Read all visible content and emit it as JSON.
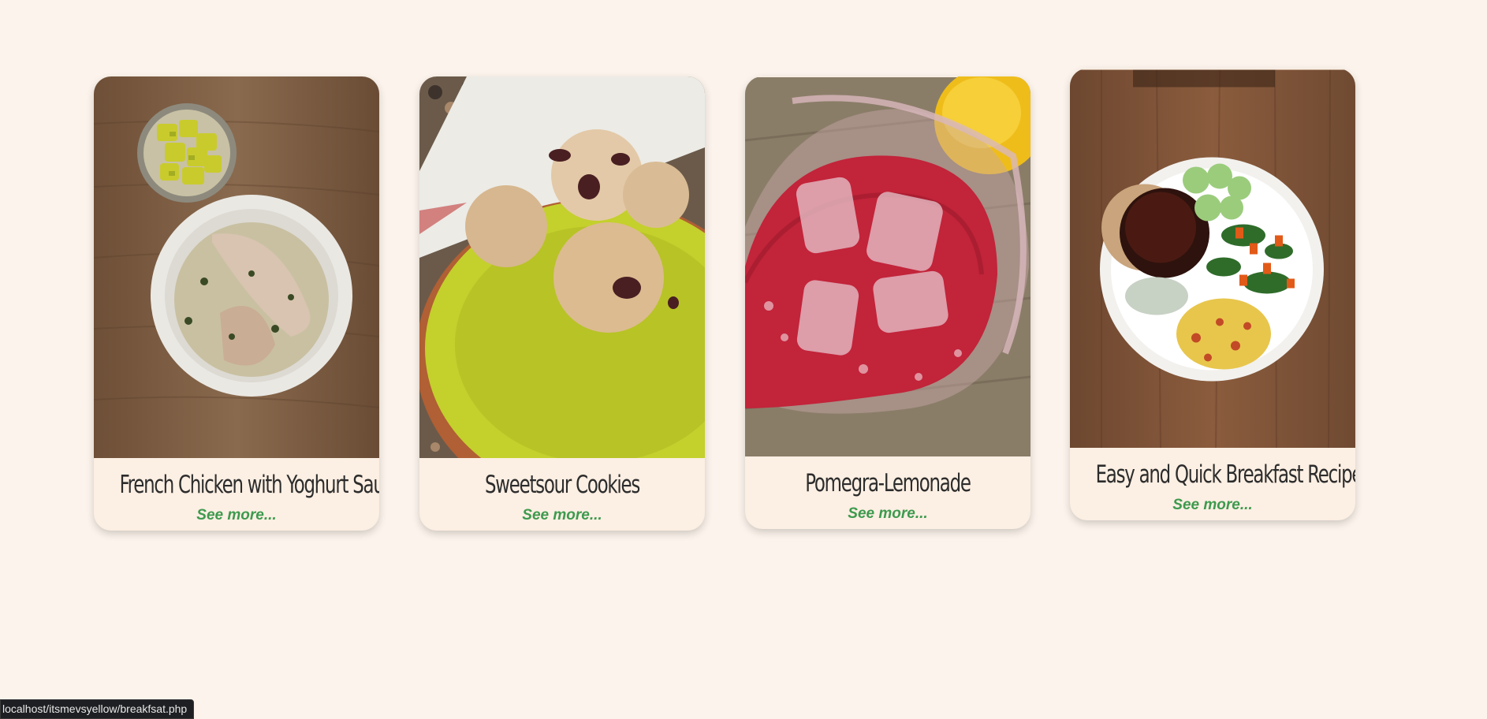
{
  "cards": [
    {
      "title": "French Chicken with Yoghurt Sause",
      "link_label": "See more...",
      "photo_icon": "chicken-bowl-photo"
    },
    {
      "title": "Sweetsour Cookies",
      "link_label": "See more...",
      "photo_icon": "cookies-plate-photo"
    },
    {
      "title": "Pomegra-Lemonade",
      "link_label": "See more...",
      "photo_icon": "pink-lemonade-glass-photo"
    },
    {
      "title": "Easy and Quick Breakfast Recipes",
      "link_label": "See more...",
      "photo_icon": "breakfast-plate-photo"
    }
  ],
  "status_bar": {
    "url": "localhost/itsmevsyellow/breakfsat.php"
  },
  "colors": {
    "background": "#fcf4ec",
    "card_background": "#fcefe3",
    "title_text": "#2c2c2c",
    "link_text": "#3d9a4e"
  }
}
